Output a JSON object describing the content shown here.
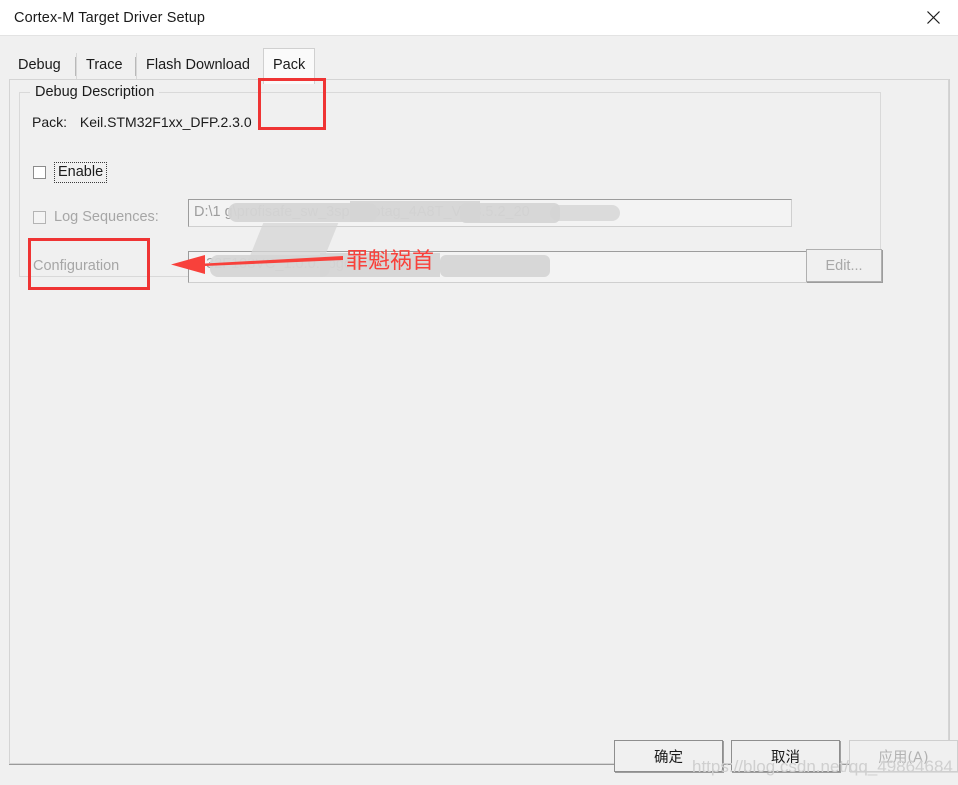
{
  "window": {
    "title": "Cortex-M Target Driver Setup",
    "close_icon": "close-icon"
  },
  "tabs": [
    {
      "label": "Debug",
      "active": false
    },
    {
      "label": "Trace",
      "active": false
    },
    {
      "label": "Flash Download",
      "active": false
    },
    {
      "label": "Pack",
      "active": true
    }
  ],
  "group": {
    "title": "Debug Description",
    "pack_label": "Pack:",
    "pack_value": "Keil.STM32F1xx_DFP.2.3.0",
    "enable": {
      "label": "Enable",
      "checked": false,
      "focused": true
    },
    "log_sequences": {
      "label": "Log Sequences:",
      "checked": false,
      "enabled": false,
      "value": "D:\\1                                                                g\\profisafe_sw_3sp+Protag_4A8T_V1.8.5.2_20"
    },
    "configuration": {
      "label": "Configuration",
      "enabled": false,
      "value": "                                                  M32F103VC_1.0.0.dbgconf",
      "edit_label": "Edit..."
    }
  },
  "annotations": {
    "rect_enable_color": "#ef3434",
    "rect_tab_color": "#ef3434",
    "arrow_color": "#f8413b",
    "note_text": "罪魁祸首"
  },
  "buttons": {
    "ok": "确定",
    "cancel": "取消",
    "apply": "应用(A)"
  },
  "watermark": "https://blog.csdn.net/qq_49864684"
}
